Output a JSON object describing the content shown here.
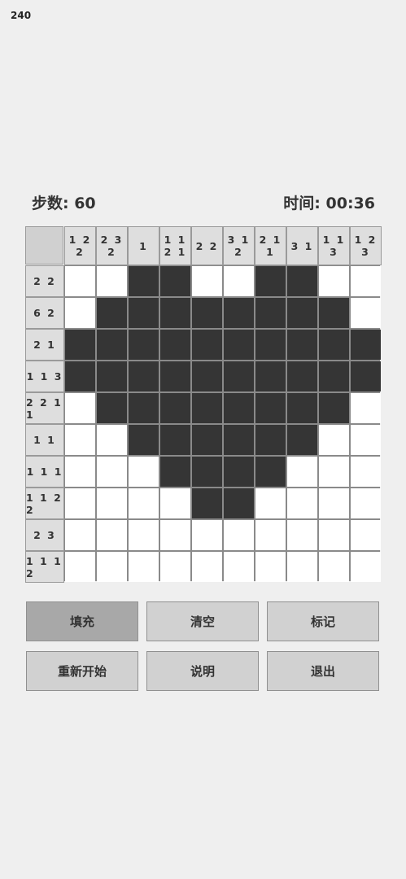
{
  "fps": "240",
  "status": {
    "steps": "步数: 60",
    "timer": "时间: 00:36"
  },
  "puzzle": {
    "col_clues": [
      "1 2 2",
      "2 3 2",
      "1",
      "1 1 2 1",
      "2 2",
      "3 1 2",
      "2 1 1",
      "3 1",
      "1 1 3",
      "1 2 3"
    ],
    "row_clues": [
      "2 2",
      "6 2",
      "2 1",
      "1 1 3",
      "2 2 1 1",
      "1 1",
      "1 1 1",
      "1 1 2 2",
      "2 3",
      "1 1 1 2"
    ],
    "grid": [
      "0011001100",
      "0111111110",
      "1111111111",
      "1111111111",
      "0111111110",
      "0011111100",
      "0001111000",
      "0000110000",
      "0000000000",
      "0000000000"
    ]
  },
  "buttons": {
    "fill": "填充",
    "clear": "清空",
    "mark": "标记",
    "restart": "重新开始",
    "help": "说明",
    "quit": "退出"
  },
  "active_mode": "fill"
}
